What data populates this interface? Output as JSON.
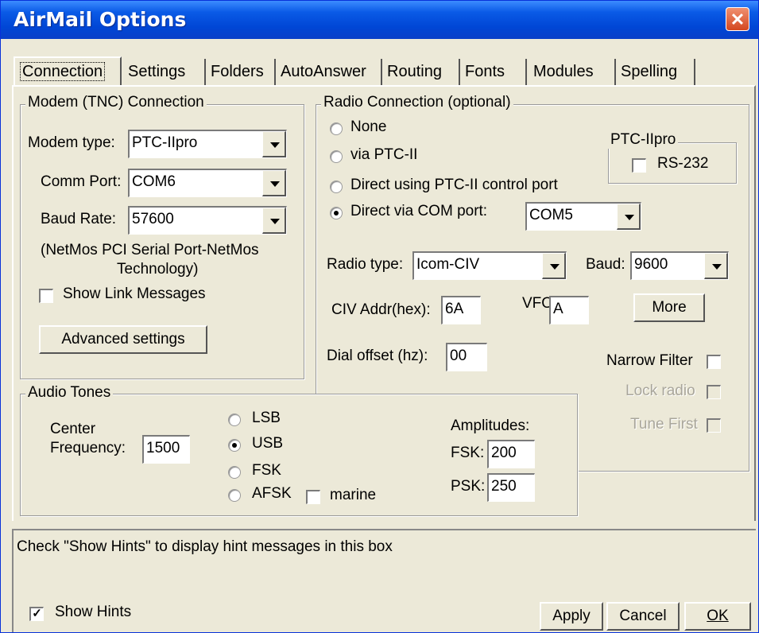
{
  "window": {
    "title": "AirMail Options",
    "close_glyph": "✕"
  },
  "tabs": [
    {
      "label": "Connection",
      "active": true
    },
    {
      "label": "Settings"
    },
    {
      "label": "Folders"
    },
    {
      "label": "AutoAnswer"
    },
    {
      "label": "Routing"
    },
    {
      "label": "Fonts"
    },
    {
      "label": "Modules"
    },
    {
      "label": "Spelling"
    }
  ],
  "modem": {
    "legend": "Modem (TNC) Connection",
    "modem_type_label": "Modem type:",
    "modem_type_value": "PTC-IIpro",
    "comm_port_label": "Comm Port:",
    "comm_port_value": "COM6",
    "baud_rate_label": "Baud Rate:",
    "baud_rate_value": "57600",
    "device_line1": "(NetMos PCI Serial Port-NetMos",
    "device_line2": "Technology)",
    "show_link_label": "Show Link Messages",
    "show_link_checked": false,
    "advanced_button": "Advanced settings"
  },
  "radio": {
    "legend": "Radio Connection (optional)",
    "options": [
      {
        "label": "None",
        "selected": false
      },
      {
        "label": "via PTC-II",
        "selected": false
      },
      {
        "label": "Direct using PTC-II control port",
        "selected": false
      },
      {
        "label": "Direct via COM port:",
        "selected": true
      }
    ],
    "com_port_value": "COM5",
    "ptc_legend": "PTC-IIpro",
    "rs232_label": "RS-232",
    "rs232_checked": false,
    "radio_type_label": "Radio type:",
    "radio_type_value": "Icom-CIV",
    "baud_label": "Baud:",
    "baud_value": "9600",
    "civ_label": "CIV Addr(hex):",
    "civ_value": "6A",
    "vfo_label": "VFO:",
    "vfo_value": "A",
    "more_button": "More",
    "dial_offset_label": "Dial offset (hz):",
    "dial_offset_value": "00",
    "narrow_filter_label": "Narrow Filter",
    "lock_radio_label": "Lock radio",
    "tune_first_label": "Tune First"
  },
  "audio": {
    "legend": "Audio Tones",
    "center_label1": "Center",
    "center_label2": "Frequency:",
    "center_value": "1500",
    "modes": [
      {
        "label": "LSB",
        "selected": false
      },
      {
        "label": "USB",
        "selected": true
      },
      {
        "label": "FSK",
        "selected": false
      },
      {
        "label": "AFSK",
        "selected": false
      }
    ],
    "marine_label": "marine",
    "amplitudes_label": "Amplitudes:",
    "fsk_label": "FSK:",
    "fsk_value": "200",
    "psk_label": "PSK:",
    "psk_value": "250"
  },
  "hints": {
    "message": "Check \"Show Hints\" to display hint messages in this box",
    "show_hints_label": "Show Hints",
    "show_hints_checked": true
  },
  "buttons": {
    "apply": "Apply",
    "cancel": "Cancel",
    "ok": "OK"
  },
  "colors": {
    "titlebar": "#0a5ae6",
    "face": "#ece9d8",
    "close": "#d4471f"
  }
}
